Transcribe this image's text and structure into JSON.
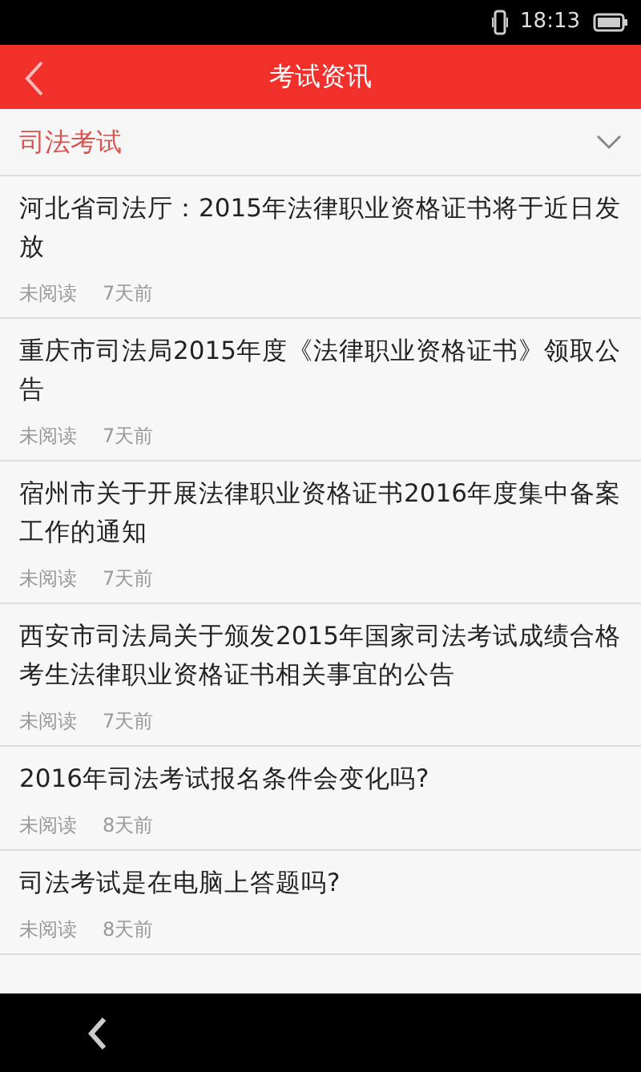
{
  "status_bar": {
    "time": "18:13"
  },
  "header": {
    "title": "考试资讯"
  },
  "category": {
    "label": "司法考试",
    "expanded": false
  },
  "articles": [
    {
      "title": "河北省司法厅：2015年法律职业资格证书将于近日发放",
      "read_state": "未阅读",
      "age": "7天前"
    },
    {
      "title": "重庆市司法局2015年度《法律职业资格证书》领取公告",
      "read_state": "未阅读",
      "age": "7天前"
    },
    {
      "title": "宿州市关于开展法律职业资格证书2016年度集中备案工作的通知",
      "read_state": "未阅读",
      "age": "7天前"
    },
    {
      "title": "西安市司法局关于颁发2015年国家司法考试成绩合格考生法律职业资格证书相关事宜的公告",
      "read_state": "未阅读",
      "age": "7天前"
    },
    {
      "title": "2016年司法考试报名条件会变化吗?",
      "read_state": "未阅读",
      "age": "8天前"
    },
    {
      "title": "司法考试是在电脑上答题吗?",
      "read_state": "未阅读",
      "age": "8天前"
    }
  ]
}
